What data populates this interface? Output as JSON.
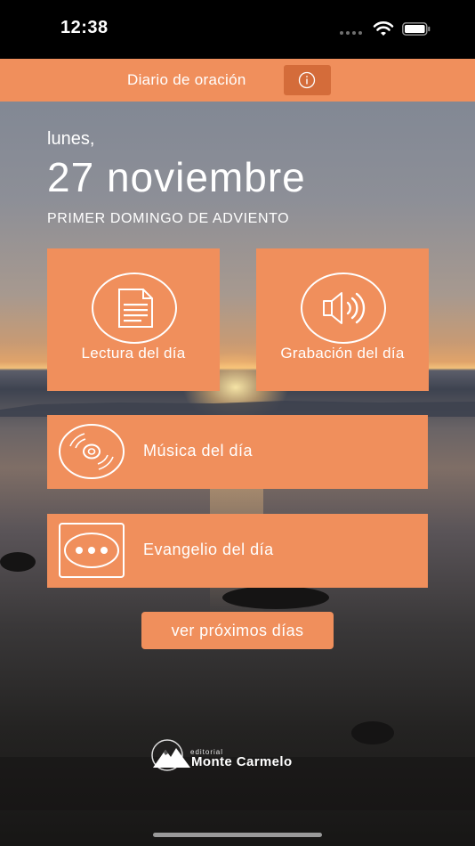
{
  "status_bar": {
    "time": "12:38"
  },
  "header": {
    "title": "Diario de oración",
    "info_icon": "info-icon"
  },
  "day": {
    "weekday": "lunes,",
    "date": "27 noviembre",
    "liturgical": "PRIMER DOMINGO DE ADVIENTO"
  },
  "tiles": {
    "reading": {
      "label": "Lectura del día",
      "icon": "document-icon"
    },
    "recording": {
      "label": "Grabación del día",
      "icon": "speaker-icon"
    },
    "music": {
      "label": "Música del día",
      "icon": "cd-icon"
    },
    "gospel": {
      "label": "Evangelio del día",
      "icon": "more-icon"
    }
  },
  "next_days": {
    "label": "ver próximos días"
  },
  "publisher": {
    "small": "editorial",
    "name": "Monte Carmelo"
  },
  "colors": {
    "accent": "#f08f5c",
    "accent_dark": "#d46c3a"
  }
}
